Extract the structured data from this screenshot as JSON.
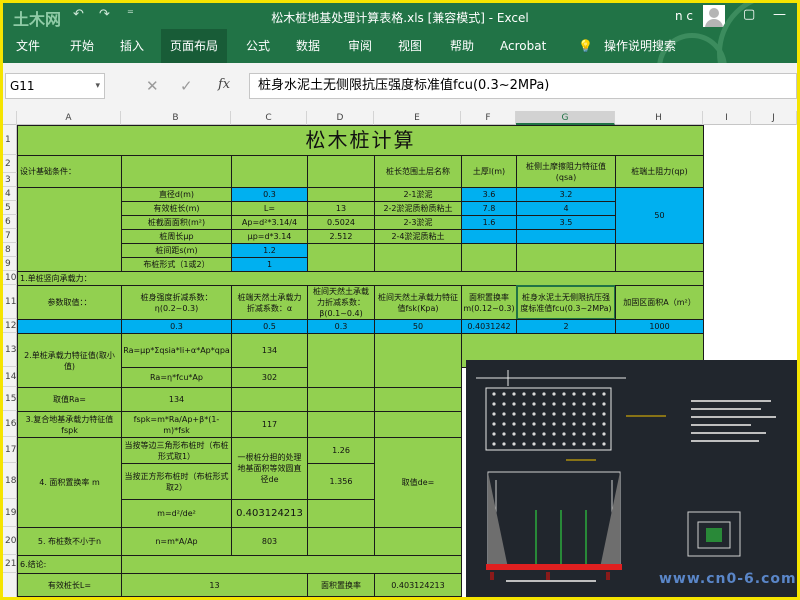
{
  "window": {
    "title": "松木桩地基处理计算表格.xls  [兼容模式]  -  Excel",
    "user_initials": "n c",
    "logo_text": "土木网",
    "undo_glyph": "↶",
    "redo_glyph": "↷",
    "qat_more": "⁼",
    "ribbon_display_icon": "▢",
    "minimize_icon": "—",
    "maximize_icon": "☐",
    "close_icon": "✕"
  },
  "ribbon": {
    "tabs": [
      "文件",
      "开始",
      "插入",
      "页面布局",
      "公式",
      "数据",
      "审阅",
      "视图",
      "帮助",
      "Acrobat"
    ],
    "active_tab": "页面布局",
    "tell_me_icon": "💡",
    "tell_me": "操作说明搜索"
  },
  "formula_bar": {
    "name_box": "G11",
    "name_box_arrow": "▾",
    "cancel_glyph": "✕",
    "enter_glyph": "✓",
    "fx": "fx",
    "content": "桩身水泥土无侧限抗压强度标准值fcu(0.3~2MPa)"
  },
  "columns": [
    "A",
    "B",
    "C",
    "D",
    "E",
    "F",
    "G",
    "H",
    "I",
    "J"
  ],
  "selected_column": "G",
  "rows": [
    "1",
    "2",
    "3",
    "4",
    "5",
    "6",
    "7",
    "8",
    "9",
    "10",
    "11",
    "12",
    "13",
    "14",
    "15",
    "16",
    "17",
    "18",
    "19",
    "20",
    "21"
  ],
  "sheet": {
    "title": "松木桩计算",
    "design_conditions": "设计基础条件：",
    "diameter": "直径d(m)",
    "diameter_val": "0.3",
    "eff_length": "有效桩长(m)",
    "eff_length_c": "L=",
    "eff_length_val": "13",
    "area": "桩截面面积(m²)",
    "area_formula": "Ap=d²*3.14/4",
    "area_val": "0.5024",
    "perimeter": "桩周长μp",
    "perimeter_formula": "μp=d*3.14",
    "perimeter_val": "2.512",
    "spacing": "桩间距s(m)",
    "spacing_val": "1.2",
    "layout": "布桩形式（1或2）",
    "layout_val": "1",
    "soil_header": "桩长范围土层名称",
    "thickness_header": "土厚l(m)",
    "friction_header": "桩侧土摩擦阻力特征值(qsa)",
    "tip_header": "桩端土阻力(qp)",
    "soil1": "2-1淤泥",
    "soil1_thk": "3.6",
    "soil1_q": "3.2",
    "soil2": "2-2淤泥质粉质粘土",
    "soil2_thk": "7.8",
    "soil2_q": "4",
    "soil3": "2-3淤泥",
    "soil3_thk": "1.6",
    "soil3_q": "3.5",
    "soil4": "2-4淤泥质粘土",
    "tip_val": "50",
    "s1": "1.单桩竖向承载力：",
    "param": "参数取值：：",
    "eta": "桩身强度折减系数：η(0.2~0.3)",
    "alpha": "桩端天然土承载力折减系数：α",
    "beta": "桩间天然土承载力折减系数：β(0.1~0.4)",
    "fsk": "桩间天然土承载力特征值fsk(Kpa)",
    "m_header": "面积置换率m(0.12~0.3)",
    "fcu_header": "桩身水泥土无侧限抗压强度标准值fcu(0.3~2MPa)",
    "area_a": "加固区面积A（m²）",
    "eta_val": "0.3",
    "alpha_val": "0.5",
    "beta_val": "0.3",
    "fsk_val": "50",
    "m_val": "0.4031242",
    "fcu_val": "2",
    "a_val": "1000",
    "s2": "2.单桩承载力特征值(取小值)",
    "ra1": "Ra=μp*Σqsia*li+α*Ap*qpa",
    "ra1_val": "134",
    "ra2": "Ra=η*fcu*Ap",
    "ra2_val": "302",
    "take_ra": "取值Ra=",
    "take_ra_val": "134",
    "s3": "3.复合地基承载力特征值fspk",
    "fspk": "fspk=m*Ra/Ap+β*(1-m)*fsk",
    "fspk_val": "117",
    "s4": "4. 面积置换率    m",
    "tri": "当按等边三角形布桩时（布桩形式取1）",
    "sq": "当按正方形布桩时（布桩形式取2）",
    "pile_de": "一根桩分担的处理地基面积等效圆直径de",
    "tri_val": "1.26",
    "sq_val": "1.356",
    "take_de": "取值de=",
    "m_formula": "m=d²/de²",
    "m_res": "0.403124213",
    "s5": "5. 布桩数不小于n",
    "n_formula": "n=m*A/Ap",
    "n_val": "803",
    "s6": "6.结论:",
    "eff2": "有效桩长L=",
    "eff2_val": "13",
    "repl": "面积置换率",
    "repl_val": "0.403124213"
  },
  "watermark": "www.cn0-6.com"
}
